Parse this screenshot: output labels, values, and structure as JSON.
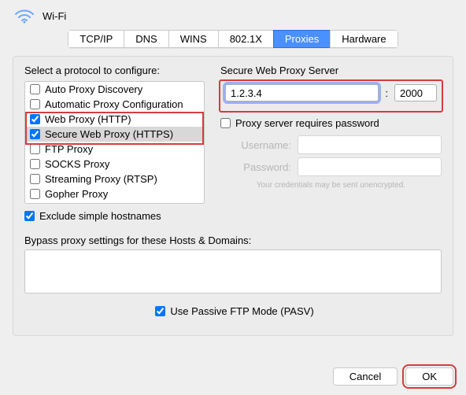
{
  "header": {
    "title": "Wi-Fi"
  },
  "tabs": [
    "TCP/IP",
    "DNS",
    "WINS",
    "802.1X",
    "Proxies",
    "Hardware"
  ],
  "active_tab": 4,
  "protocol_label": "Select a protocol to configure:",
  "protocols": [
    {
      "label": "Auto Proxy Discovery",
      "checked": false
    },
    {
      "label": "Automatic Proxy Configuration",
      "checked": false
    },
    {
      "label": "Web Proxy (HTTP)",
      "checked": true
    },
    {
      "label": "Secure Web Proxy (HTTPS)",
      "checked": true,
      "selected": true
    },
    {
      "label": "FTP Proxy",
      "checked": false
    },
    {
      "label": "SOCKS Proxy",
      "checked": false
    },
    {
      "label": "Streaming Proxy (RTSP)",
      "checked": false
    },
    {
      "label": "Gopher Proxy",
      "checked": false
    }
  ],
  "server_label": "Secure Web Proxy Server",
  "server_addr": "1.2.3.4",
  "server_port": "2000",
  "requires_pw_label": "Proxy server requires password",
  "requires_pw": false,
  "username_label": "Username:",
  "password_label": "Password:",
  "username": "",
  "password": "",
  "cred_note": "Your credentials may be sent unencrypted.",
  "exclude_label": "Exclude simple hostnames",
  "exclude": true,
  "bypass_label": "Bypass proxy settings for these Hosts & Domains:",
  "bypass": "",
  "pasv_label": "Use Passive FTP Mode (PASV)",
  "pasv": true,
  "cancel": "Cancel",
  "ok": "OK",
  "colon": ":"
}
